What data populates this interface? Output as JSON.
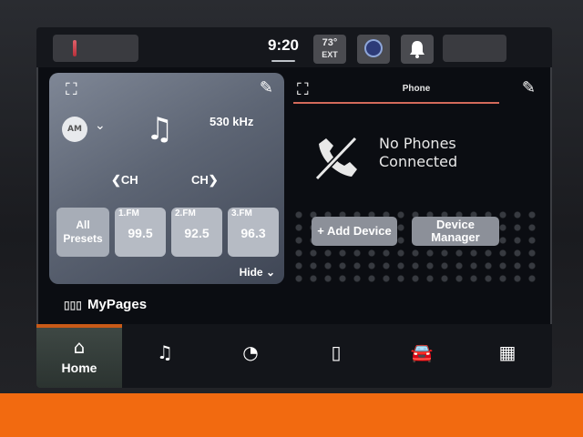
{
  "status_bar": {
    "time": "9:20",
    "outside_temp": {
      "value": "73°",
      "unit": "EXT"
    }
  },
  "radio": {
    "band": "AM",
    "frequency": "530 kHz",
    "ch_prev": "CH",
    "ch_next": "CH",
    "presets_button": "All Presets",
    "presets": [
      {
        "label": "1.FM",
        "value": "99.5"
      },
      {
        "label": "2.FM",
        "value": "92.5"
      },
      {
        "label": "3.FM",
        "value": "96.3"
      }
    ],
    "hide_label": "Hide"
  },
  "phone": {
    "title": "Phone",
    "message": "No Phones Connected",
    "add_device": "+ Add Device",
    "device_manager": "Device Manager"
  },
  "my_pages": "MyPages",
  "nav": {
    "items": [
      {
        "id": "home",
        "label": "Home",
        "icon": "home-icon",
        "active": true
      },
      {
        "id": "media",
        "label": "",
        "icon": "music-icon"
      },
      {
        "id": "comfort",
        "label": "",
        "icon": "gauge-icon"
      },
      {
        "id": "phone",
        "label": "",
        "icon": "phone-icon"
      },
      {
        "id": "vehicle",
        "label": "",
        "icon": "car-icon"
      },
      {
        "id": "apps",
        "label": "",
        "icon": "apps-grid-icon"
      }
    ]
  },
  "colors": {
    "accent": "#f26a10",
    "phone_rule": "#d36a5a"
  }
}
